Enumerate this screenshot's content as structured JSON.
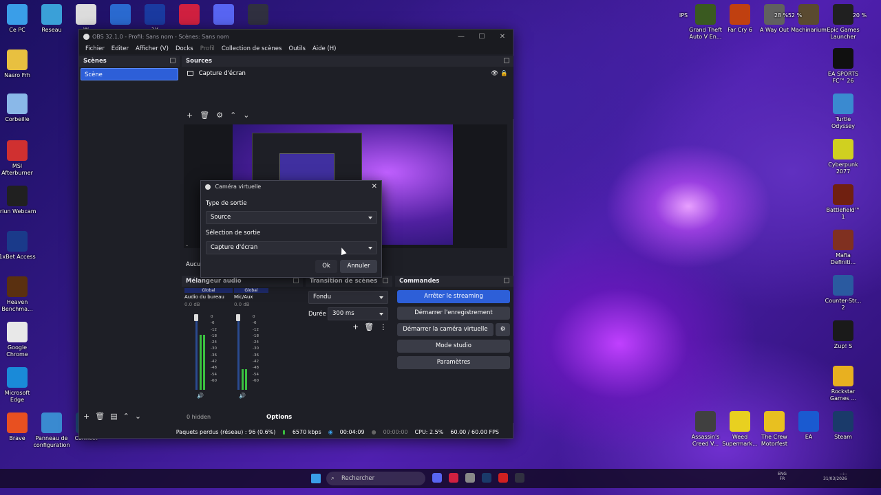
{
  "desktop": {
    "left_icons": [
      {
        "label": "Ce PC",
        "color": "#3a9ee8"
      },
      {
        "label": "Reseau",
        "color": "#3aa0d8"
      },
      {
        "label": "Nasro Frh",
        "color": "#e8c040"
      },
      {
        "label": "Corbeille",
        "color": "#8ab8e8"
      },
      {
        "label": "MSI Afterburner",
        "color": "#d03030"
      },
      {
        "label": "Iriun Webcam",
        "color": "#202020"
      },
      {
        "label": "1xBet Access",
        "color": "#1a3a8a"
      },
      {
        "label": "Heaven Benchma...",
        "color": "#5a3010"
      },
      {
        "label": "Google Chrome",
        "color": "#e8e8e8"
      },
      {
        "label": "Microsoft Edge",
        "color": "#1a8ad8"
      },
      {
        "label": "Brave",
        "color": "#e85020"
      },
      {
        "label": "Panneau de configuration",
        "color": "#3a8ad0"
      },
      {
        "label": "Connect",
        "color": "#205080"
      }
    ],
    "top_icons": [
      {
        "label": "W",
        "color": "#ddd"
      },
      {
        "label": "",
        "color": "#2a6ad0"
      },
      {
        "label": "1X",
        "color": "#1a3aa0"
      },
      {
        "label": "",
        "color": "#d02040"
      },
      {
        "label": "",
        "color": "#5865f2"
      },
      {
        "label": "",
        "color": "#303040"
      }
    ],
    "right_icons": [
      {
        "label": "Grand Theft Auto V En...",
        "color": "#3a5a20"
      },
      {
        "label": "Far Cry 6",
        "color": "#c04010"
      },
      {
        "label": "A Way Out",
        "color": "#606060"
      },
      {
        "label": "Machinarium",
        "color": "#5a4a30"
      },
      {
        "label": "Epic Games Launcher",
        "color": "#202020"
      },
      {
        "label": "EA SPORTS FC™ 26",
        "color": "#101010"
      },
      {
        "label": "Turtle Odyssey",
        "color": "#3a8ad0"
      },
      {
        "label": "Cyberpunk 2077",
        "color": "#d0d020"
      },
      {
        "label": "Battlefield™ 1",
        "color": "#702010"
      },
      {
        "label": "Mafia Definiti...",
        "color": "#803020"
      },
      {
        "label": "Counter-Str... 2",
        "color": "#2a5aa0"
      },
      {
        "label": "Zup! S",
        "color": "#1a1a1a"
      },
      {
        "label": "Rockstar Games ...",
        "color": "#e8b020"
      },
      {
        "label": "Steam",
        "color": "#1a3a6a"
      },
      {
        "label": "EA",
        "color": "#1a5ad0"
      },
      {
        "label": "The Crew Motorfest",
        "color": "#e8c020"
      },
      {
        "label": "Weed Supermark...",
        "color": "#e8d020"
      },
      {
        "label": "Assassin's Creed V...",
        "color": "#404040"
      }
    ],
    "overlay": {
      "ips": "IPS",
      "proc1": "28 %",
      "proc2": "52 %",
      "proc3": "20 %"
    }
  },
  "obs": {
    "title": "OBS 32.1.0 - Profil: Sans nom - Scènes: Sans nom",
    "menu": [
      "Fichier",
      "Editer",
      "Afficher (V)",
      "Docks",
      "Profil",
      "Collection de scènes",
      "Outils",
      "Aide (H)"
    ],
    "scenes": {
      "title": "Scènes",
      "items": [
        "Scène"
      ]
    },
    "sources": {
      "title": "Sources",
      "items": [
        "Capture d'écran"
      ]
    },
    "status_left": "Aucu",
    "mixer": {
      "title": "Mélangeur audio",
      "channels": [
        {
          "tag": "Global",
          "name": "Audio du bureau",
          "db": "0.0 dB"
        },
        {
          "tag": "Global",
          "name": "Mic/Aux",
          "db": "0.0 dB"
        }
      ],
      "ticks": [
        "0",
        "-6",
        "-12",
        "-18",
        "-24",
        "-30",
        "-36",
        "-42",
        "-48",
        "-54",
        "-60"
      ],
      "hidden": "0 hidden",
      "options": "Options"
    },
    "transitions": {
      "title": "Transition de scènes",
      "type": "Fondu",
      "duration_label": "Durée",
      "duration": "300 ms"
    },
    "controls": {
      "title": "Commandes",
      "buttons": [
        "Arrêter le streaming",
        "Démarrer l'enregistrement",
        "Démarrer la caméra virtuelle",
        "Mode studio",
        "Paramètres"
      ]
    },
    "statusbar": {
      "dropped": "Paquets perdus (réseau) : 96 (0.6%)",
      "kbps": "6570 kbps",
      "stream_time": "00:04:09",
      "rec_time": "00:00:00",
      "cpu": "CPU: 2.5%",
      "fps": "60.00 / 60.00 FPS"
    }
  },
  "dialog": {
    "title": "Caméra virtuelle",
    "type_label": "Type de sortie",
    "type_value": "Source",
    "selection_label": "Sélection de sortie",
    "selection_value": "Capture d'écran",
    "ok": "Ok",
    "cancel": "Annuler"
  },
  "taskbar": {
    "search": "Rechercher",
    "lang": "ENG",
    "lang2": "FR",
    "time": "--:--",
    "date": "31/03/2026"
  }
}
